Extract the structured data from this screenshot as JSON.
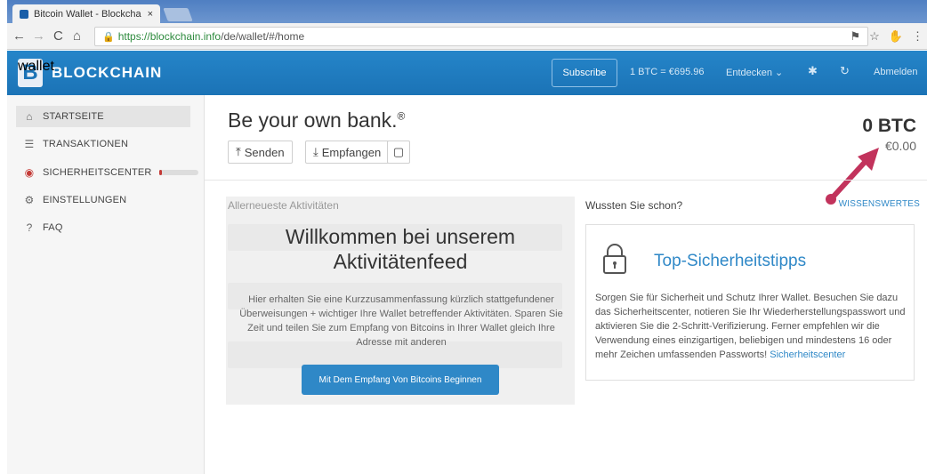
{
  "browser": {
    "tab_title": "Bitcoin Wallet - Blockcha",
    "tab_close": "×",
    "url_host": "https://blockchain.info",
    "url_path": "/de/wallet/#/home"
  },
  "header": {
    "logo_text": "BLOCKCHAIN",
    "logo_sub": "wallet",
    "subscribe_label": "Subscribe",
    "rate": "1 BTC = €695.96",
    "discover": "Entdecken",
    "logout": "Abmelden"
  },
  "sidebar": {
    "items": [
      {
        "label": "STARTSEITE",
        "icon": "home-icon"
      },
      {
        "label": "TRANSAKTIONEN",
        "icon": "list-icon"
      },
      {
        "label": "SICHERHEITSCENTER",
        "icon": "shield-icon"
      },
      {
        "label": "EINSTELLUNGEN",
        "icon": "gear-icon"
      },
      {
        "label": "FAQ",
        "icon": "help-icon"
      }
    ]
  },
  "main": {
    "headline": "Be your own bank.",
    "headline_mark": "®",
    "send_label": "Senden",
    "receive_label": "Empfangen",
    "balance_btc": "0 BTC",
    "balance_eur": "€0.00"
  },
  "activity": {
    "title": "Allerneueste Aktivitäten",
    "welcome_line1": "Willkommen bei unserem",
    "welcome_line2": "Aktivitätenfeed",
    "text": "Hier erhalten Sie eine Kurzzusammenfassung kürzlich stattgefundener Überweisungen + wichtiger Ihre Wallet betreffender Aktivitäten. Sparen Sie Zeit und teilen Sie zum Empfang von Bitcoins in Ihrer Wallet gleich Ihre Adresse mit anderen",
    "button": "Mit Dem Empfang Von Bitcoins Beginnen"
  },
  "tips": {
    "heading": "Wussten Sie schon?",
    "link": "WISSENSWERTES",
    "title": "Top-Sicherheitstipps",
    "text": "Sorgen Sie für Sicherheit und Schutz Ihrer Wallet. Besuchen Sie dazu das Sicherheitscenter, notieren Sie Ihr Wiederherstellungspasswort und aktivieren Sie die 2-Schritt-Verifizierung. Ferner empfehlen wir die Verwendung eines einzigartigen, beliebigen und mindestens 16 oder mehr Zeichen umfassenden Passworts!",
    "text_link": "Sicherheitscenter"
  },
  "colors": {
    "brand_blue": "#1b73b6",
    "accent_blue": "#2f88c7",
    "alert_red": "#c43a36",
    "arrow_pink": "#c2335c"
  }
}
